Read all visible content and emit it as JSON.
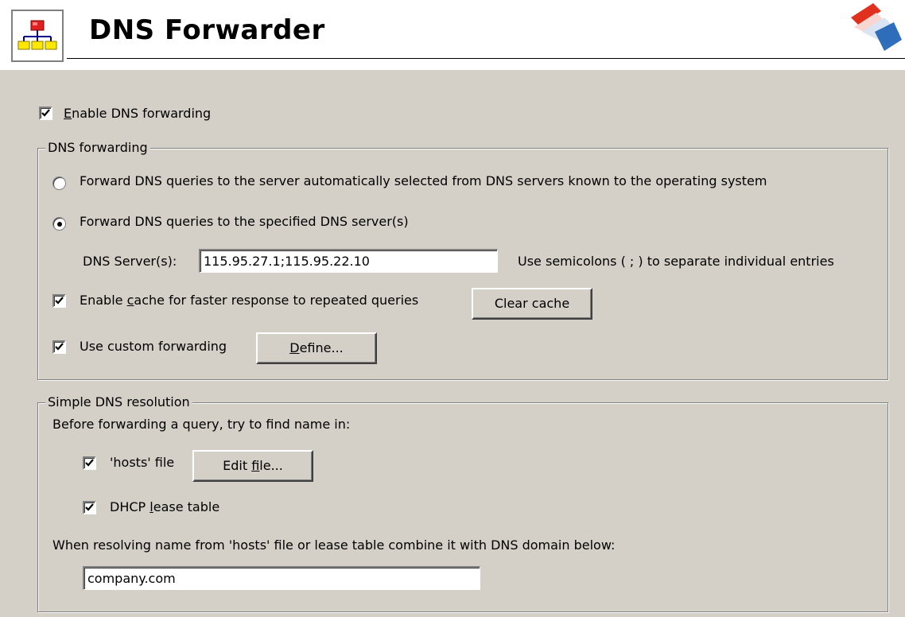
{
  "header": {
    "title": "DNS Forwarder",
    "icon": "network-hierarchy-icon"
  },
  "enable_forwarding": {
    "label_underlined": "E",
    "label_rest": "nable DNS forwarding",
    "checked": true
  },
  "dns_forwarding_group": {
    "title": "DNS forwarding",
    "radio_auto": {
      "label": "Forward DNS queries to the server automatically selected from DNS servers known to the operating system",
      "selected": false
    },
    "radio_specified": {
      "label": "Forward DNS queries to the specified DNS server(s)",
      "selected": true
    },
    "dns_servers": {
      "label": "DNS Server(s):",
      "value": "115.95.27.1;115.95.22.10",
      "hint": "Use semicolons ( ; ) to separate individual entries"
    },
    "enable_cache": {
      "label_before": "Enable ",
      "label_underlined": "c",
      "label_after": "ache for faster response to repeated queries",
      "checked": true
    },
    "clear_cache_button": "Clear cache",
    "custom_forwarding": {
      "label": "Use custom forwarding",
      "checked": true
    },
    "define_button": {
      "underlined": "D",
      "rest": "efine..."
    }
  },
  "simple_resolution_group": {
    "title": "Simple DNS resolution",
    "intro": "Before forwarding a query, try to find name in:",
    "hosts_file": {
      "label": "'hosts' file",
      "checked": true
    },
    "edit_file_button": {
      "before": "Edit ",
      "underlined": "f",
      "after": "ile..."
    },
    "dhcp_lease": {
      "label_before": "DHCP ",
      "label_underlined": "l",
      "label_after": "ease table",
      "checked": true
    },
    "combine_label": "When resolving name from 'hosts' file or lease table combine it with DNS domain below:",
    "domain_value": "company.com"
  },
  "colors": {
    "panel_bg": "#d4d0c8",
    "accent_red": "#e0301e",
    "accent_blue": "#1a5fb4"
  }
}
